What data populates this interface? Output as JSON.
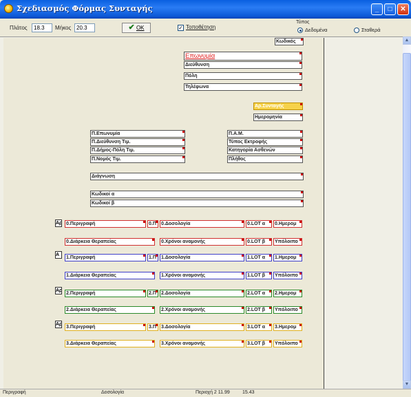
{
  "window": {
    "title": "Σχεδιασμός Φόρμας Συνταγής",
    "minimize": "_",
    "maximize": "□",
    "close": "✕"
  },
  "toolbar": {
    "width_label": "Πλάτος",
    "width_value": "18.3",
    "length_label": "Μήκος",
    "length_value": "20.3",
    "ok_label": "OK",
    "ok_icon": "✔",
    "coords_checkbox_label": "Τοποθέτηση",
    "coords_checked": true,
    "type_group_label": "Τύπος",
    "type_options": [
      "Δεδομένα",
      "Σταθερά"
    ],
    "type_selected": "Δεδομένα"
  },
  "fields": {
    "code": "Κωδικός",
    "name": "Επωνυμία",
    "address": "Διεύθυνση",
    "city": "Πόλη",
    "phone": "Τηλέφωνα",
    "rx_no": "Αρ.Συνταγής",
    "date": "Ημερομηνία",
    "p_name": "Π.Επωνυμία",
    "p_address": "Π.Διεύθυνση Τιμ.",
    "p_city": "Π.Δήμος-Πόλη Τιμ.",
    "p_county": "Π.Νομός Τιμ.",
    "amka": "Π.Α.Μ.",
    "coverage": "Τύπος Εκτροφής",
    "category": "Κατηγορία Ασθενών",
    "count": "Πλήθος",
    "diagnosis": "Διάγνωση",
    "codes_a": "Κωδικοί α",
    "codes_b": "Κωδικοί β"
  },
  "rows": [
    {
      "tag": "Αρ",
      "desc": "0.Περιγραφή",
      "small": "0.Π",
      "dose": "0.Δοσολογία",
      "lot_a": "0.LOT α",
      "date": "0.Ημερομ",
      "duration": "0.Διάρκεια Θεραπείας",
      "wait": "0.Χρόνοι αναμονής",
      "lot_b": "0.LOT β",
      "rest": "Υπόλοιπο"
    },
    {
      "tag": "Α",
      "desc": "1.Περιγραφή",
      "small": "1.Π",
      "dose": "1.Δοσολογία",
      "lot_a": "1.LOT α",
      "date": "1.Ημερομ",
      "duration": "1.Διάρκεια Θεραπείας",
      "wait": "1.Χρόνοι αναμονής",
      "lot_b": "1.LOT β",
      "rest": "Υπόλοιπο"
    },
    {
      "tag": "Αρ",
      "desc": "2.Περιγραφή",
      "small": "2.Π",
      "dose": "2.Δοσολογία",
      "lot_a": "2.LOT α",
      "date": "2.Ημερομ",
      "duration": "2.Διάρκεια Θεραπείας",
      "wait": "2.Χρόνοι αναμονής",
      "lot_b": "2.LOT β",
      "rest": "Υπόλοιπο"
    },
    {
      "tag": "Αρ",
      "desc": "3.Περιγραφή",
      "small": "3.Π",
      "dose": "3.Δοσολογία",
      "lot_a": "3.LOT α",
      "date": "3.Ημερομ",
      "duration": "3.Διάρκεια Θεραπείας",
      "wait": "3.Χρόνοι αναμονής",
      "lot_b": "3.LOT β",
      "rest": "Υπόλοιπο"
    }
  ],
  "statusbar": {
    "cell1": "Περιγραφή",
    "cell2": "Δοσολογία",
    "cell3": "Περιοχή 2 11.99",
    "cell4": "15.43"
  },
  "colors": {
    "row0": "#d03030",
    "row1": "#4040c8",
    "row2": "#2a8a2a",
    "row3": "#e0b020",
    "highlight": "#f6d24a",
    "title_bar": "#0a5fe0"
  }
}
